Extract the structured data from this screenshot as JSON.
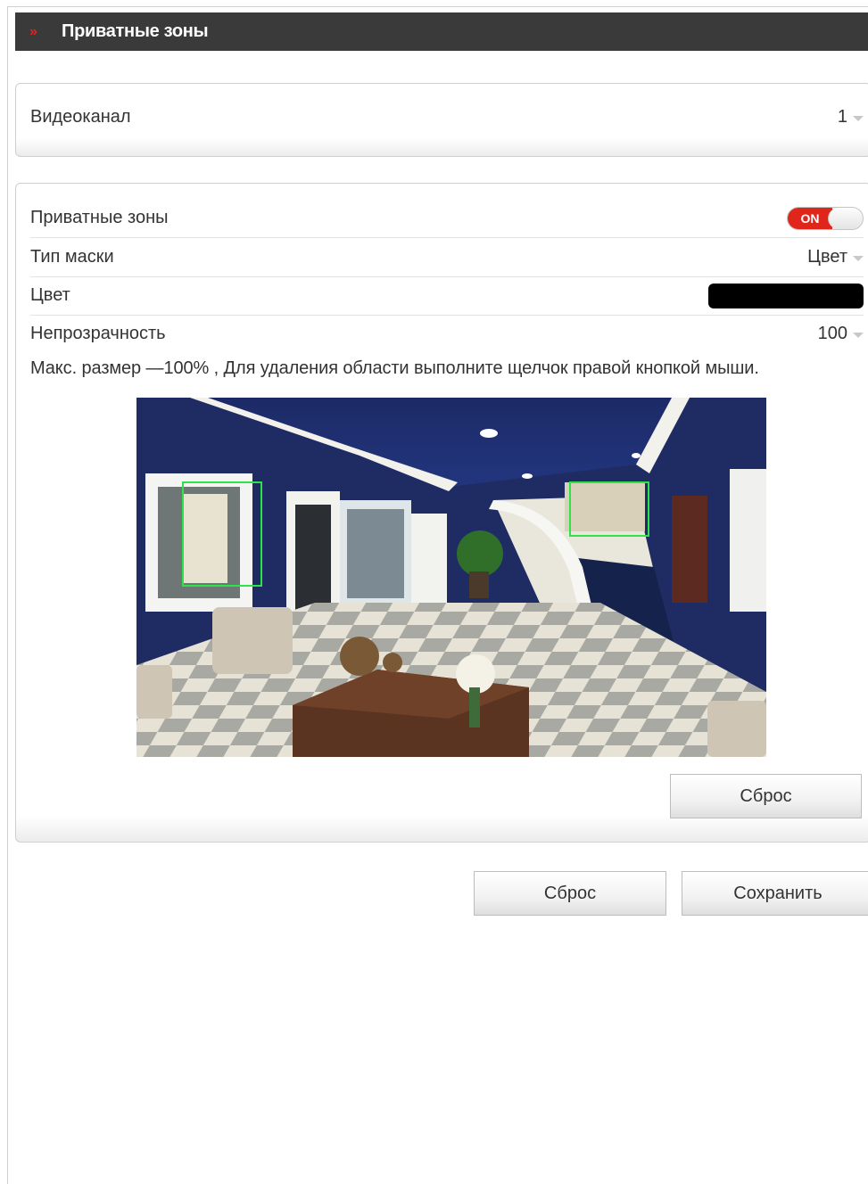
{
  "header": {
    "title": "Приватные зоны"
  },
  "channel": {
    "label": "Видеоканал",
    "value": "1"
  },
  "privacy": {
    "enabled_label": "Приватные зоны",
    "toggle_state": "ON",
    "mask_type_label": "Тип маски",
    "mask_type_value": "Цвет",
    "color_label": "Цвет",
    "color_value": "#000000",
    "opacity_label": "Непрозрачность",
    "opacity_value": "100",
    "hint": "Макс. размер —100% , Для удаления области выполните щелчок правой кнопкой мыши.",
    "zones_count": 2,
    "reset_label": "Сброс"
  },
  "footer": {
    "reset_label": "Сброс",
    "save_label": "Сохранить"
  },
  "colors": {
    "accent": "#e0261b",
    "header_bg": "#3a3a3a",
    "zone_border": "#2ee34a"
  }
}
